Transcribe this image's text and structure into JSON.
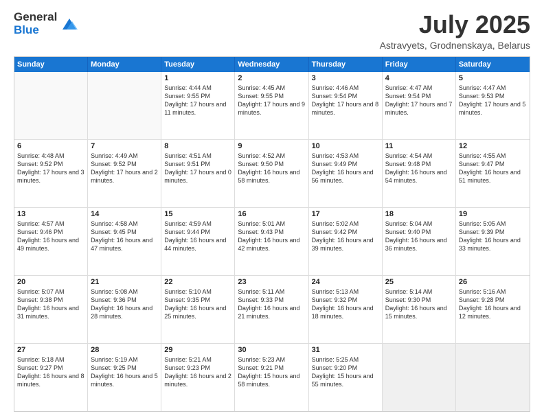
{
  "header": {
    "logo_general": "General",
    "logo_blue": "Blue",
    "title": "July 2025",
    "subtitle": "Astravyets, Grodnenskaya, Belarus"
  },
  "calendar": {
    "days": [
      "Sunday",
      "Monday",
      "Tuesday",
      "Wednesday",
      "Thursday",
      "Friday",
      "Saturday"
    ],
    "weeks": [
      [
        {
          "day": "",
          "content": ""
        },
        {
          "day": "",
          "content": ""
        },
        {
          "day": "1",
          "content": "Sunrise: 4:44 AM\nSunset: 9:55 PM\nDaylight: 17 hours and 11 minutes."
        },
        {
          "day": "2",
          "content": "Sunrise: 4:45 AM\nSunset: 9:55 PM\nDaylight: 17 hours and 9 minutes."
        },
        {
          "day": "3",
          "content": "Sunrise: 4:46 AM\nSunset: 9:54 PM\nDaylight: 17 hours and 8 minutes."
        },
        {
          "day": "4",
          "content": "Sunrise: 4:47 AM\nSunset: 9:54 PM\nDaylight: 17 hours and 7 minutes."
        },
        {
          "day": "5",
          "content": "Sunrise: 4:47 AM\nSunset: 9:53 PM\nDaylight: 17 hours and 5 minutes."
        }
      ],
      [
        {
          "day": "6",
          "content": "Sunrise: 4:48 AM\nSunset: 9:52 PM\nDaylight: 17 hours and 3 minutes."
        },
        {
          "day": "7",
          "content": "Sunrise: 4:49 AM\nSunset: 9:52 PM\nDaylight: 17 hours and 2 minutes."
        },
        {
          "day": "8",
          "content": "Sunrise: 4:51 AM\nSunset: 9:51 PM\nDaylight: 17 hours and 0 minutes."
        },
        {
          "day": "9",
          "content": "Sunrise: 4:52 AM\nSunset: 9:50 PM\nDaylight: 16 hours and 58 minutes."
        },
        {
          "day": "10",
          "content": "Sunrise: 4:53 AM\nSunset: 9:49 PM\nDaylight: 16 hours and 56 minutes."
        },
        {
          "day": "11",
          "content": "Sunrise: 4:54 AM\nSunset: 9:48 PM\nDaylight: 16 hours and 54 minutes."
        },
        {
          "day": "12",
          "content": "Sunrise: 4:55 AM\nSunset: 9:47 PM\nDaylight: 16 hours and 51 minutes."
        }
      ],
      [
        {
          "day": "13",
          "content": "Sunrise: 4:57 AM\nSunset: 9:46 PM\nDaylight: 16 hours and 49 minutes."
        },
        {
          "day": "14",
          "content": "Sunrise: 4:58 AM\nSunset: 9:45 PM\nDaylight: 16 hours and 47 minutes."
        },
        {
          "day": "15",
          "content": "Sunrise: 4:59 AM\nSunset: 9:44 PM\nDaylight: 16 hours and 44 minutes."
        },
        {
          "day": "16",
          "content": "Sunrise: 5:01 AM\nSunset: 9:43 PM\nDaylight: 16 hours and 42 minutes."
        },
        {
          "day": "17",
          "content": "Sunrise: 5:02 AM\nSunset: 9:42 PM\nDaylight: 16 hours and 39 minutes."
        },
        {
          "day": "18",
          "content": "Sunrise: 5:04 AM\nSunset: 9:40 PM\nDaylight: 16 hours and 36 minutes."
        },
        {
          "day": "19",
          "content": "Sunrise: 5:05 AM\nSunset: 9:39 PM\nDaylight: 16 hours and 33 minutes."
        }
      ],
      [
        {
          "day": "20",
          "content": "Sunrise: 5:07 AM\nSunset: 9:38 PM\nDaylight: 16 hours and 31 minutes."
        },
        {
          "day": "21",
          "content": "Sunrise: 5:08 AM\nSunset: 9:36 PM\nDaylight: 16 hours and 28 minutes."
        },
        {
          "day": "22",
          "content": "Sunrise: 5:10 AM\nSunset: 9:35 PM\nDaylight: 16 hours and 25 minutes."
        },
        {
          "day": "23",
          "content": "Sunrise: 5:11 AM\nSunset: 9:33 PM\nDaylight: 16 hours and 21 minutes."
        },
        {
          "day": "24",
          "content": "Sunrise: 5:13 AM\nSunset: 9:32 PM\nDaylight: 16 hours and 18 minutes."
        },
        {
          "day": "25",
          "content": "Sunrise: 5:14 AM\nSunset: 9:30 PM\nDaylight: 16 hours and 15 minutes."
        },
        {
          "day": "26",
          "content": "Sunrise: 5:16 AM\nSunset: 9:28 PM\nDaylight: 16 hours and 12 minutes."
        }
      ],
      [
        {
          "day": "27",
          "content": "Sunrise: 5:18 AM\nSunset: 9:27 PM\nDaylight: 16 hours and 8 minutes."
        },
        {
          "day": "28",
          "content": "Sunrise: 5:19 AM\nSunset: 9:25 PM\nDaylight: 16 hours and 5 minutes."
        },
        {
          "day": "29",
          "content": "Sunrise: 5:21 AM\nSunset: 9:23 PM\nDaylight: 16 hours and 2 minutes."
        },
        {
          "day": "30",
          "content": "Sunrise: 5:23 AM\nSunset: 9:21 PM\nDaylight: 15 hours and 58 minutes."
        },
        {
          "day": "31",
          "content": "Sunrise: 5:25 AM\nSunset: 9:20 PM\nDaylight: 15 hours and 55 minutes."
        },
        {
          "day": "",
          "content": ""
        },
        {
          "day": "",
          "content": ""
        }
      ]
    ]
  }
}
